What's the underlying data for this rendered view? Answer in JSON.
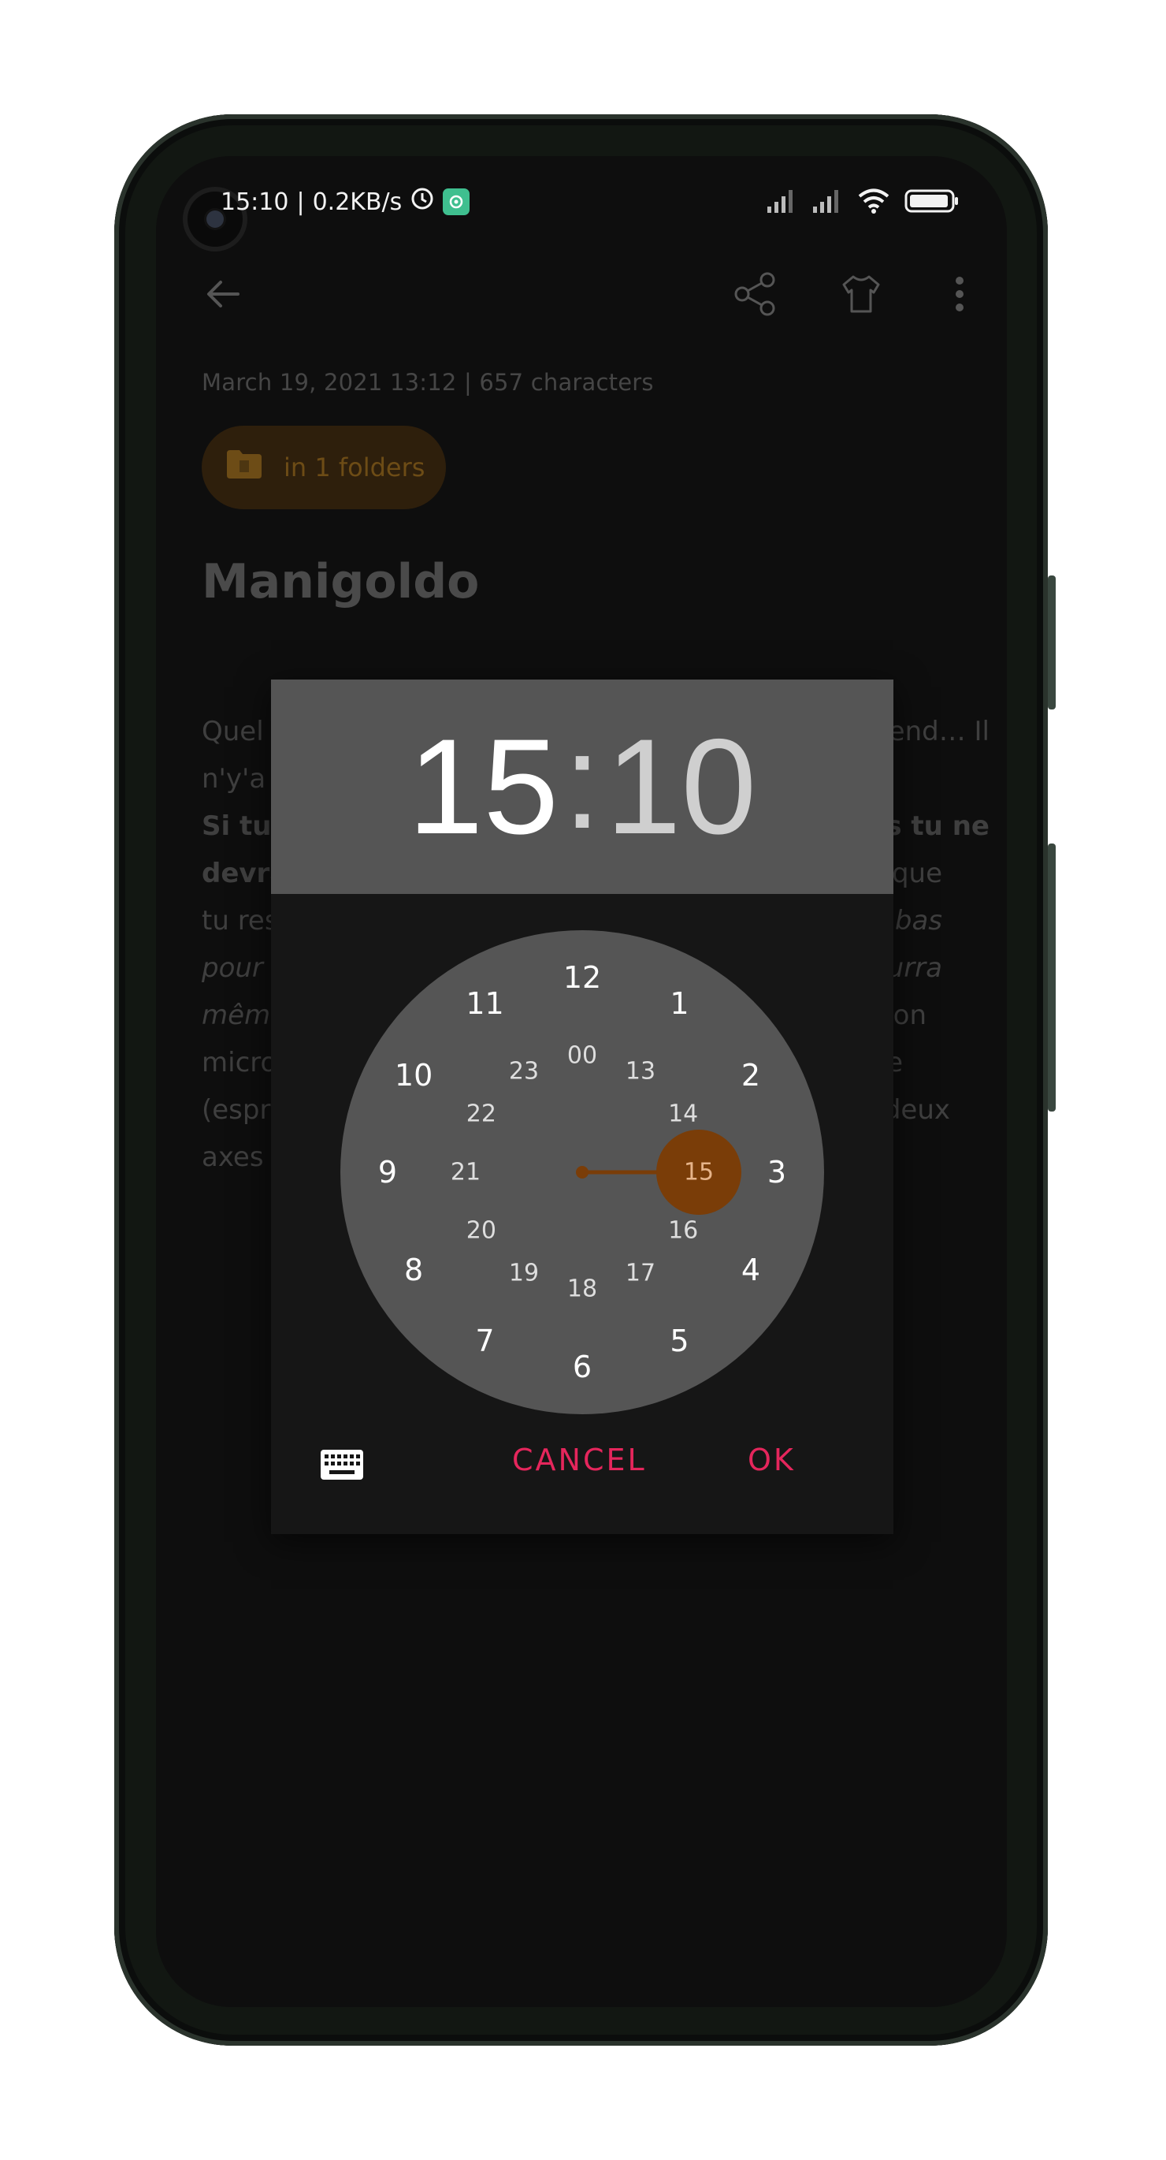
{
  "status_bar": {
    "time": "15:10",
    "speed": "0.2KB/s",
    "separator": "|"
  },
  "toolbar": {
    "back_icon": "arrow-left-icon",
    "share_icon": "share-icon",
    "theme_icon": "tshirt-icon",
    "more_icon": "more-vert-icon"
  },
  "note": {
    "meta": "March 19, 2021 13:12 | 657 characters",
    "folder_chip": "in 1 folders",
    "title": "Manigoldo",
    "lines": [
      {
        "left": "Quel",
        "right": "end… Il"
      },
      {
        "left": "n'y'a",
        "right": ""
      },
      {
        "left": "Si tu",
        "right": "s tu ne"
      },
      {
        "left": "devra",
        "right": "que"
      },
      {
        "left": "tu res",
        "right": "bas"
      },
      {
        "left": "pour",
        "right": "ourra"
      },
      {
        "left": "mêm",
        "right": "sion"
      },
      {
        "left": "micro",
        "right": "ue"
      },
      {
        "left": "(espr",
        "right": "deux"
      },
      {
        "left": "axes",
        "right": ""
      }
    ]
  },
  "time_picker": {
    "hour": "15",
    "colon": ":",
    "minute": "10",
    "selected_hour": "15",
    "outer_hours": [
      "12",
      "1",
      "2",
      "3",
      "4",
      "5",
      "6",
      "7",
      "8",
      "9",
      "10",
      "11"
    ],
    "inner_hours": [
      "00",
      "13",
      "14",
      "15",
      "16",
      "17",
      "18",
      "19",
      "20",
      "21",
      "22",
      "23"
    ],
    "keyboard_icon": "keyboard-icon",
    "cancel_label": "CANCEL",
    "ok_label": "OK"
  },
  "colors": {
    "accent": "#e5265c",
    "selector": "#7a3d08",
    "dialog_header": "#555555"
  }
}
